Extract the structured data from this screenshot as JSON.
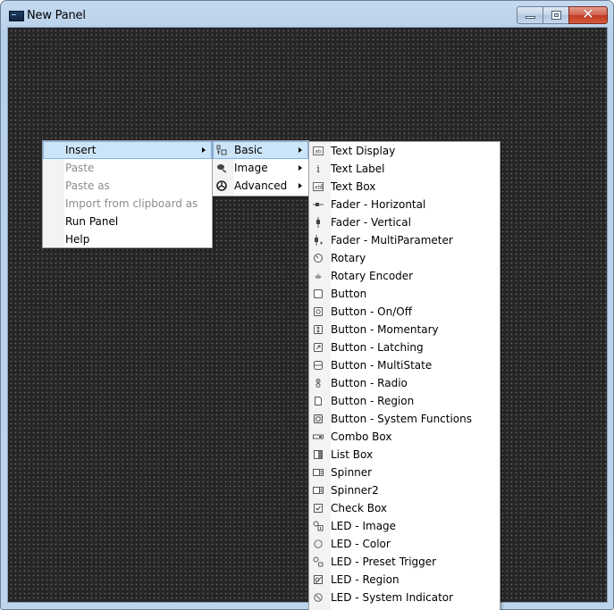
{
  "window": {
    "title": "New Panel",
    "controls": {
      "minimize": "minimize",
      "maximize": "maximize",
      "close": "✕"
    }
  },
  "context_menu": {
    "items": [
      {
        "label": "Insert",
        "enabled": true,
        "submenu": true,
        "highlighted": true
      },
      {
        "label": "Paste",
        "enabled": false
      },
      {
        "label": "Paste as",
        "enabled": false
      },
      {
        "label": "Import from clipboard as",
        "enabled": false
      },
      {
        "label": "Run Panel",
        "enabled": true
      },
      {
        "label": "Help",
        "enabled": true
      }
    ]
  },
  "insert_menu": {
    "items": [
      {
        "label": "Basic",
        "icon": "basic-controls-icon",
        "submenu": true,
        "highlighted": true
      },
      {
        "label": "Image",
        "icon": "image-icon",
        "submenu": true
      },
      {
        "label": "Advanced",
        "icon": "advanced-icon",
        "submenu": true
      }
    ]
  },
  "basic_menu": {
    "items": [
      {
        "label": "Text Display",
        "icon": "text-display-icon",
        "glyph": "ab"
      },
      {
        "label": "Text Label",
        "icon": "text-label-icon",
        "glyph": "i"
      },
      {
        "label": "Text Box",
        "icon": "text-box-icon",
        "glyph": "ab"
      },
      {
        "label": "Fader - Horizontal",
        "icon": "fader-horizontal-icon",
        "glyph": "-▪-"
      },
      {
        "label": "Fader - Vertical",
        "icon": "fader-vertical-icon",
        "glyph": "▮"
      },
      {
        "label": "Fader - MultiParameter",
        "icon": "fader-multiparameter-icon",
        "glyph": "▮."
      },
      {
        "label": "Rotary",
        "icon": "rotary-icon",
        "glyph": "◔"
      },
      {
        "label": "Rotary Encoder",
        "icon": "rotary-encoder-icon",
        "glyph": "≈"
      },
      {
        "label": "Button",
        "icon": "button-icon",
        "glyph": ""
      },
      {
        "label": "Button - On/Off",
        "icon": "button-onoff-icon",
        "glyph": "◎"
      },
      {
        "label": "Button - Momentary",
        "icon": "button-momentary-icon",
        "glyph": "↕"
      },
      {
        "label": "Button - Latching",
        "icon": "button-latching-icon",
        "glyph": "↗"
      },
      {
        "label": "Button - MultiState",
        "icon": "button-multistate-icon",
        "glyph": "☰"
      },
      {
        "label": "Button - Radio",
        "icon": "button-radio-icon",
        "glyph": "8"
      },
      {
        "label": "Button - Region",
        "icon": "button-region-icon",
        "glyph": "🗋"
      },
      {
        "label": "Button - System Functions",
        "icon": "button-system-functions-icon",
        "glyph": "◙"
      },
      {
        "label": "Combo Box",
        "icon": "combo-box-icon",
        "glyph": "▭"
      },
      {
        "label": "List Box",
        "icon": "list-box-icon",
        "glyph": "▯"
      },
      {
        "label": "Spinner",
        "icon": "spinner-icon",
        "glyph": "◫"
      },
      {
        "label": "Spinner2",
        "icon": "spinner2-icon",
        "glyph": "◫"
      },
      {
        "label": "Check Box",
        "icon": "check-box-icon",
        "glyph": "☑"
      },
      {
        "label": "LED - Image",
        "icon": "led-image-icon",
        "glyph": "○▫"
      },
      {
        "label": "LED - Color",
        "icon": "led-color-icon",
        "glyph": "○"
      },
      {
        "label": "LED - Preset Trigger",
        "icon": "led-preset-trigger-icon",
        "glyph": "○▫"
      },
      {
        "label": "LED - Region",
        "icon": "led-region-icon",
        "glyph": "▨"
      },
      {
        "label": "LED - System Indicator",
        "icon": "led-system-indicator-icon",
        "glyph": "⊘"
      }
    ]
  },
  "colors": {
    "canvas_background": "#262626",
    "canvas_grid_dot": "#6a6a6a",
    "menu_highlight": "#cce4f7",
    "menu_highlight_border": "#7eb4ea",
    "disabled_text": "#8d8d8d",
    "close_button": "#c9462c"
  }
}
